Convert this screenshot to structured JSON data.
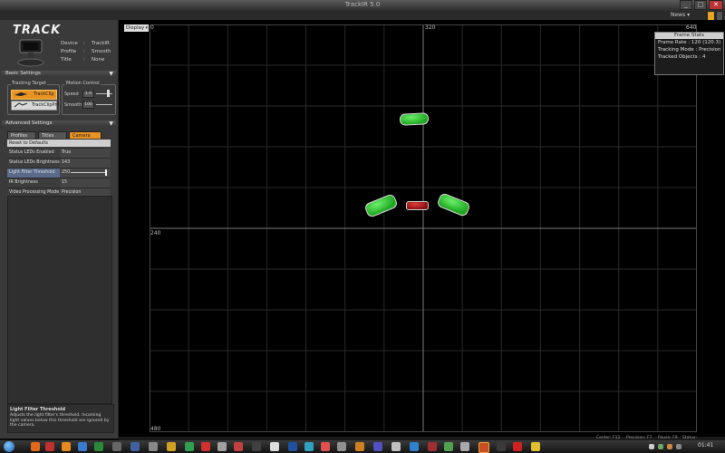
{
  "window": {
    "title": "TrackIR 5.0"
  },
  "titlebar_buttons": [
    "_",
    "□",
    "✕"
  ],
  "header": {
    "news_label": "News ▾"
  },
  "logo": "TRACK",
  "device_info": [
    {
      "label": "Device",
      "value": "TrackIR"
    },
    {
      "label": "Profile",
      "value": "Smooth"
    },
    {
      "label": "Title",
      "value": "None"
    }
  ],
  "basic_settings": {
    "title": "Basic Settings",
    "tracking_target": {
      "title": "Tracking Target",
      "options": [
        "TrackClip",
        "TrackClipPro"
      ],
      "selected": "TrackClip"
    },
    "motion_control": {
      "title": "Motion Control",
      "speed": {
        "label": "Speed",
        "value": "1.0"
      },
      "smooth": {
        "label": "Smooth",
        "value": "100"
      }
    }
  },
  "advanced_settings": {
    "title": "Advanced Settings",
    "tabs": [
      "Profiles",
      "Titles",
      "Camera"
    ],
    "active_tab": "Camera",
    "reset_label": "Reset to Defaults",
    "properties": [
      {
        "name": "Status LEDs Enabled",
        "value": "True"
      },
      {
        "name": "Status LEDs Brightness",
        "value": "143"
      },
      {
        "name": "Light Filter Threshold",
        "value": "250"
      },
      {
        "name": "IR Brightness",
        "value": "15"
      },
      {
        "name": "Video Processing Mode",
        "value": "Precision"
      }
    ],
    "light_filter_slider_level": 0.98
  },
  "description": {
    "title": "Light Filter Threshold",
    "text": "Adjusts the light filter's threshold.  Incoming light values below this threshold are ignored by the camera."
  },
  "display": {
    "selector_label": "Display",
    "ticks": {
      "x0": "0",
      "xmid": "320",
      "xmax": "640",
      "ymid": "240",
      "ymax": "480"
    }
  },
  "frame_stats": {
    "title": "Frame Stats",
    "frame_rate": "Frame Rate : 120 (120.3)",
    "tracking_mode": "Tracking Mode : Precision",
    "tracked_objects_label": "Tracked Objects :",
    "tracked_objects_value": "4"
  },
  "status": {
    "center": "Center: F12",
    "precision": "Precision: F7",
    "pause": "Pause: F9",
    "status": "Status:"
  },
  "taskbar": {
    "clock": "01:41"
  },
  "colors": {
    "accent": "#e89322",
    "blob_green": "#2ecc2e",
    "blob_red": "#b01818",
    "grid": "#2a2a2a"
  }
}
